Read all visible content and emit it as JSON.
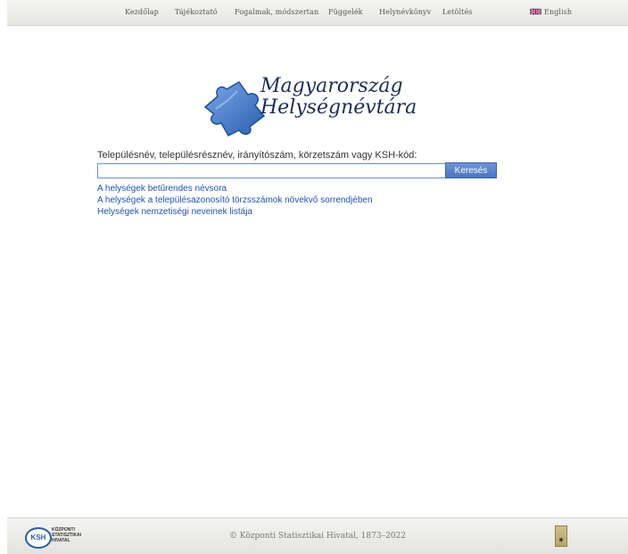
{
  "nav": {
    "items": [
      {
        "label": "Kezdőlap"
      },
      {
        "label": "Tájékoztató"
      },
      {
        "label": "Fogalmak, módszertan"
      },
      {
        "label": "Függelék"
      },
      {
        "label": "Helynévkönyv"
      },
      {
        "label": "Letöltés"
      },
      {
        "label": "English",
        "icon": "uk-flag-icon"
      }
    ]
  },
  "logo": {
    "line1": "Magyarország",
    "line2": "Helységnévtára",
    "icon": "puzzle-piece-icon",
    "color": "#3a6fc2"
  },
  "search": {
    "label": "Településnév, településrésznév, irányítószám, körzetszám vagy KSH-kód:",
    "value": "",
    "button_label": "Keresés"
  },
  "links": [
    "A helységek betűrendes névsora",
    "A helységek a településazonosító törzsszámok növekvő sorrendjében",
    "Helységek nemzetiségi neveinek listája"
  ],
  "footer": {
    "ksh_badge": "KSH",
    "ksh_name": [
      "KÖZPONTI",
      "STATISZTIKAI",
      "HIVATAL"
    ],
    "copyright": "© Központi Statisztikai Hivatal, 1873–2022",
    "book_icon": "book-icon"
  },
  "colors": {
    "link": "#2053b4",
    "button": "#4a76c1",
    "nav_bg": "#ececea"
  }
}
